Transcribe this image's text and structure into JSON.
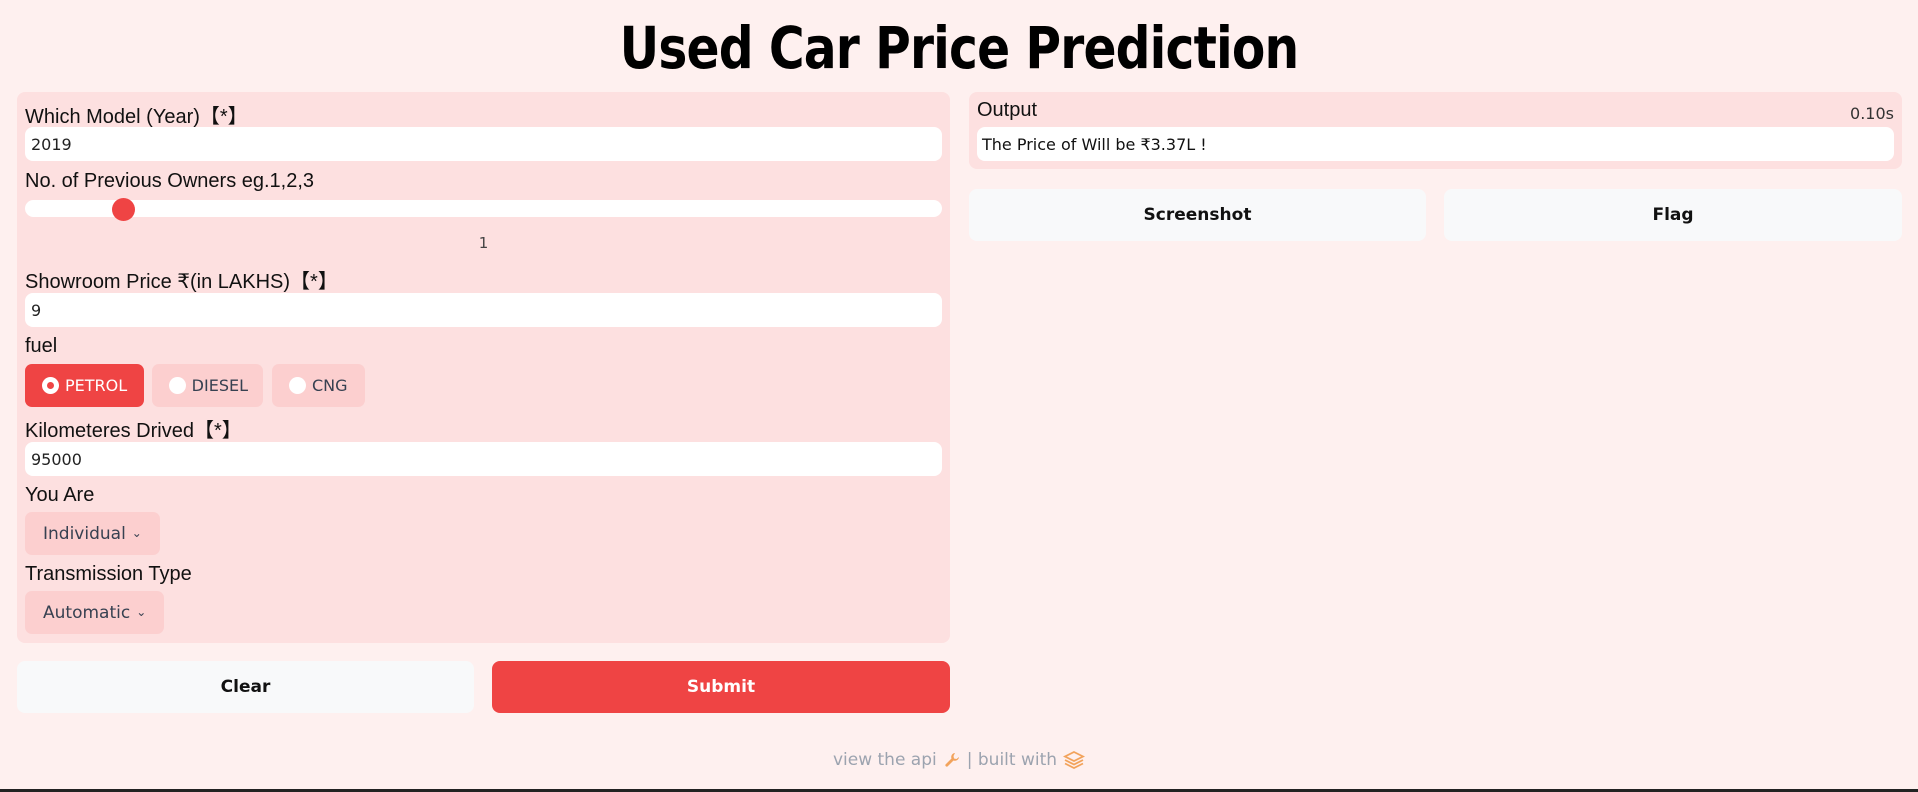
{
  "app": {
    "title": "Used Car Price Prediction"
  },
  "inputs": {
    "model_year": {
      "label": "Which Model (Year)【*】",
      "value": "2019"
    },
    "owners": {
      "label": "No. of Previous Owners eg.1,2,3",
      "value": "1",
      "slider_fraction": 0.1
    },
    "showroom_price": {
      "label": "Showroom Price ₹(in LAKHS)【*】",
      "value": "9"
    },
    "fuel": {
      "label": "fuel",
      "options": [
        "PETROL",
        "DIESEL",
        "CNG"
      ],
      "selected": "PETROL"
    },
    "kms": {
      "label": "Kilometeres Drived【*】",
      "value": "95000"
    },
    "seller": {
      "label": "You Are",
      "value": "Individual"
    },
    "transmission": {
      "label": "Transmission Type",
      "value": "Automatic"
    }
  },
  "actions": {
    "clear": "Clear",
    "submit": "Submit",
    "screenshot": "Screenshot",
    "flag": "Flag"
  },
  "output": {
    "label": "Output",
    "time": "0.10s",
    "text": "The Price of Will be  ₹3.37L !"
  },
  "footer": {
    "api_text": "view the api",
    "built_text": "| built with"
  },
  "colors": {
    "background": "#fef0ef",
    "panel": "#fde0e0",
    "accent": "#ef4444",
    "chip": "#fccfcf"
  },
  "icons": {
    "api": "wrench-icon",
    "logo": "gradio-logo-icon"
  }
}
